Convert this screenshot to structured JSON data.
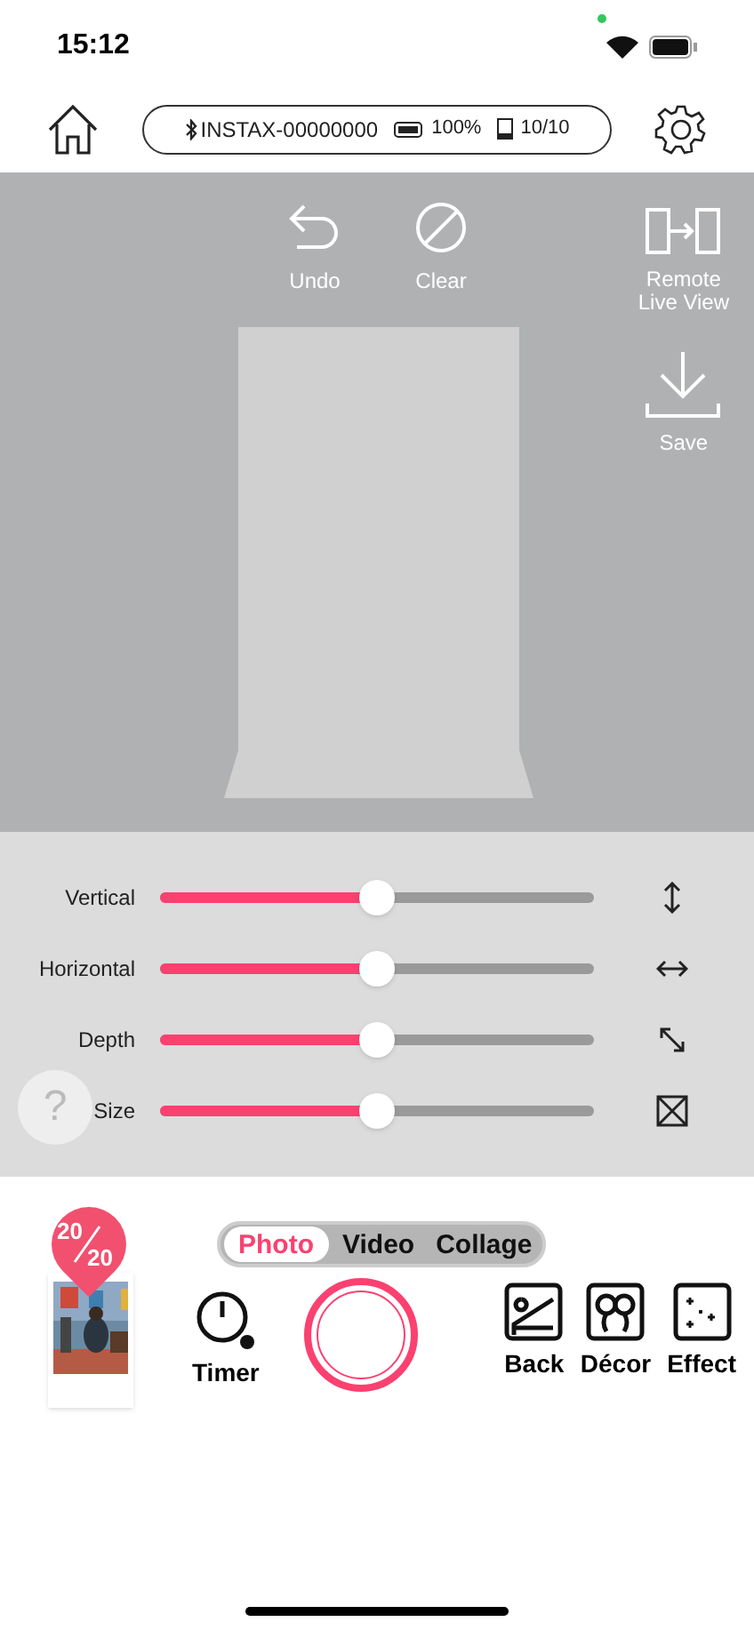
{
  "status_bar": {
    "time": "15:12"
  },
  "header": {
    "device": "INSTAX-00000000",
    "battery": "100%",
    "prints": "10/10"
  },
  "canvas_tools": [
    {
      "kind": "undo",
      "label": "Undo"
    },
    {
      "kind": "clear",
      "label": "Clear"
    }
  ],
  "side_tools": [
    {
      "kind": "remote",
      "label": "Remote\nLive View"
    },
    {
      "kind": "save",
      "label": "Save"
    }
  ],
  "sliders": [
    {
      "kind": "vertical",
      "label": "Vertical",
      "level": 0.5
    },
    {
      "kind": "horizontal",
      "label": "Horizontal",
      "level": 0.5
    },
    {
      "kind": "depth",
      "label": "Depth",
      "level": 0.5
    },
    {
      "kind": "size",
      "label": "Size",
      "level": 0.5
    }
  ],
  "help": {
    "label": "?"
  },
  "modes": [
    {
      "label": "Photo",
      "selected": true
    },
    {
      "label": "Video",
      "selected": false
    },
    {
      "label": "Collage",
      "selected": false
    }
  ],
  "film_badge": {
    "count": "20",
    "total": "20"
  },
  "tools": [
    {
      "kind": "timer",
      "label": "Timer"
    },
    {
      "kind": "back",
      "label": "Back"
    },
    {
      "kind": "decor",
      "label": "Décor"
    },
    {
      "kind": "effect",
      "label": "Effect"
    }
  ]
}
